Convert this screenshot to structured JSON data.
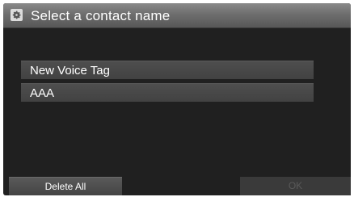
{
  "header": {
    "title": "Select a contact name",
    "icon": "gear-icon"
  },
  "contacts": [
    {
      "label": "New Voice Tag"
    },
    {
      "label": "AAA"
    }
  ],
  "footer": {
    "delete_all_label": "Delete All",
    "ok_label": "OK",
    "ok_enabled": false
  }
}
